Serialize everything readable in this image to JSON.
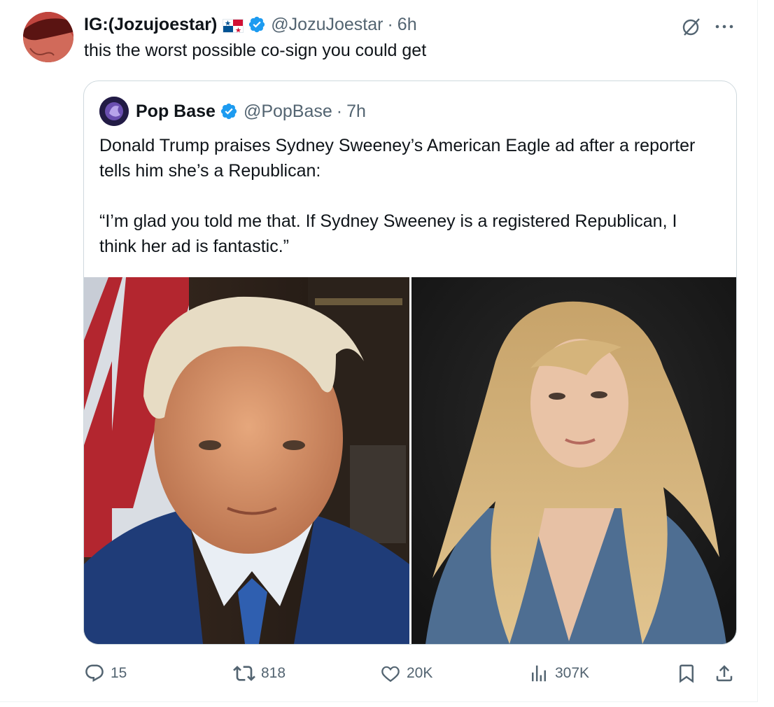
{
  "tweet": {
    "display_name": "IG:(Jozujoestar)",
    "handle": "@JozuJoestar",
    "separator": "·",
    "time": "6h",
    "text": "this the worst possible co-sign you could get",
    "avatar_icon": "red-beret-avatar",
    "flag_icon": "panama-flag-icon"
  },
  "quote": {
    "display_name": "Pop Base",
    "handle": "@PopBase",
    "separator": "·",
    "time": "7h",
    "paragraphs": [
      "Donald Trump praises Sydney Sweeney’s American Eagle ad after a reporter tells him she’s a Republican:",
      "“I’m glad you told me that. If Sydney Sweeney is a registered Republican, I think her ad is fantastic.”"
    ],
    "images": [
      "trump-portrait-photo",
      "sweeney-portrait-photo"
    ]
  },
  "actions": {
    "replies": "15",
    "reposts": "818",
    "likes": "20K",
    "views": "307K"
  },
  "colors": {
    "text": "#0f1419",
    "secondary": "#536471",
    "verified": "#1d9bf0",
    "border": "#cfd9de"
  }
}
